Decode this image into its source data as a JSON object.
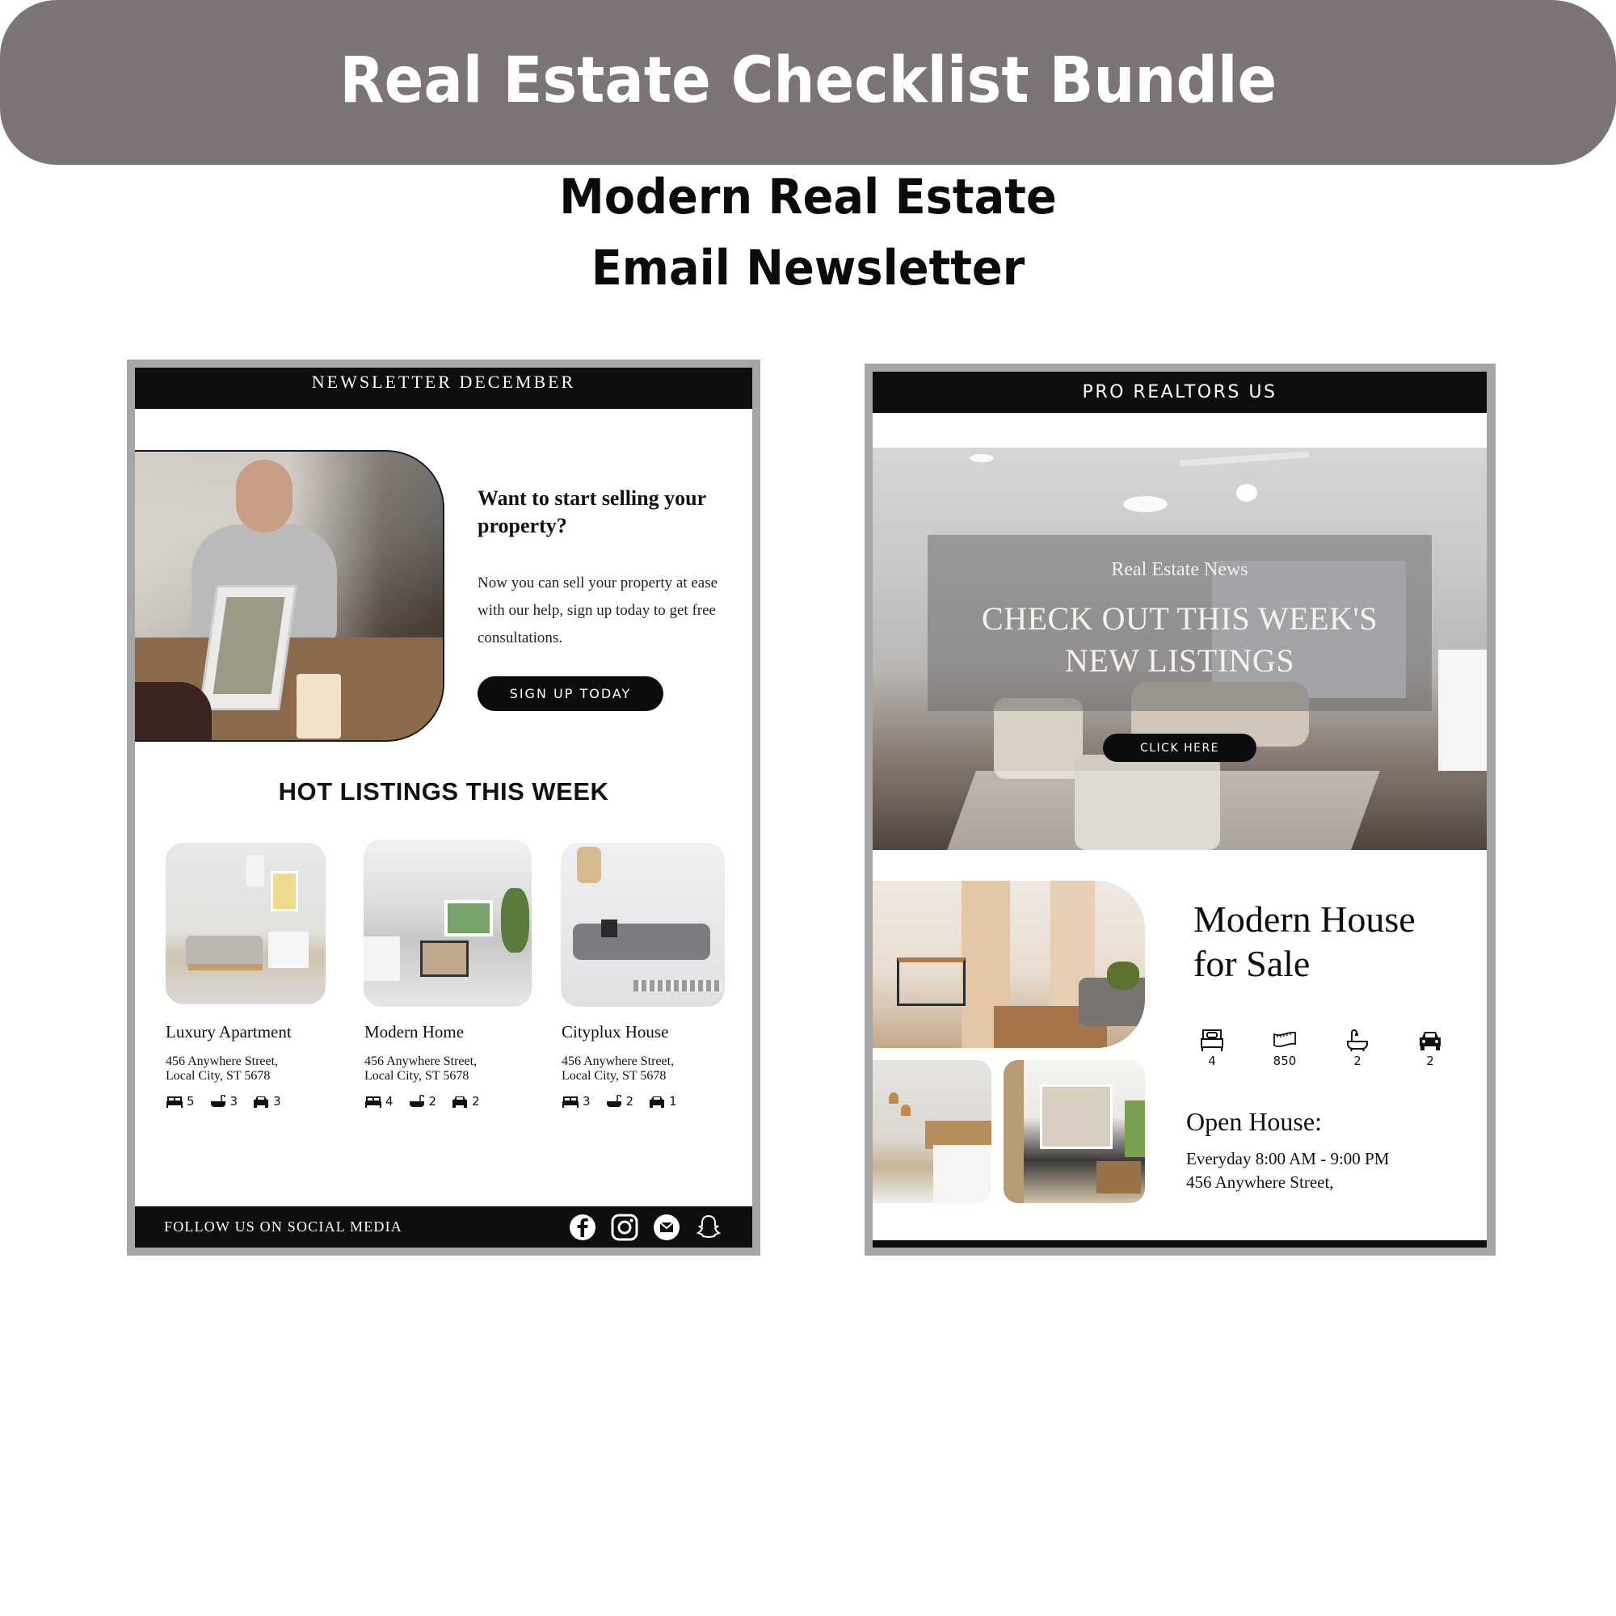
{
  "banner": {
    "title": "Real Estate Checklist Bundle",
    "color": "#7d7477"
  },
  "subtitle": {
    "line1": "Modern Real Estate",
    "line2": "Email Newsletter"
  },
  "left_newsletter": {
    "header": "NEWSLETTER DECEMBER",
    "hero": {
      "image": "business-meeting-laptop-photo",
      "heading": "Want to start selling your property?",
      "body": "Now you can sell your property at ease with our help, sign up today to get free consultations.",
      "button": "SIGN UP TODAY"
    },
    "section_title": "HOT LISTINGS THIS WEEK",
    "listings": [
      {
        "name": "Luxury Apartment",
        "address_line1": "456 Anywhere Street,",
        "address_line2": "Local City, ST 5678",
        "beds": "5",
        "baths": "3",
        "cars": "3",
        "image": "living-room-wooden-sofa-photo"
      },
      {
        "name": "Modern Home",
        "address_line1": "456 Anywhere Street,",
        "address_line2": "Local City, ST 5678",
        "beds": "4",
        "baths": "2",
        "cars": "2",
        "image": "living-room-coffee-table-photo"
      },
      {
        "name": "Cityplux House",
        "address_line1": "456 Anywhere Street,",
        "address_line2": "Local City, ST 5678",
        "beds": "3",
        "baths": "2",
        "cars": "1",
        "image": "grey-sofa-living-room-photo"
      }
    ],
    "footer": {
      "label": "FOLLOW US ON SOCIAL MEDIA",
      "social_icons": [
        "facebook-icon",
        "instagram-icon",
        "email-icon",
        "snapchat-icon"
      ]
    }
  },
  "right_newsletter": {
    "header": "PRO REALTORS US",
    "hero": {
      "image": "living-room-ceiling-fan-photo",
      "kicker": "Real Estate News",
      "headline_line1": "CHECK OUT THIS WEEK'S",
      "headline_line2": "NEW LISTINGS",
      "button": "CLICK HERE"
    },
    "gallery": [
      "living-room-plants-photo",
      "bedroom-pendant-lamps-photo",
      "shelves-living-room-photo"
    ],
    "property": {
      "title_line1": "Modern House",
      "title_line2": "for Sale",
      "features": [
        {
          "icon": "bed-icon",
          "value": "4"
        },
        {
          "icon": "area-measure-icon",
          "value": "850"
        },
        {
          "icon": "bathtub-icon",
          "value": "2"
        },
        {
          "icon": "car-icon",
          "value": "2"
        }
      ],
      "open_house_label": "Open House:",
      "hours": "Everyday 8:00 AM - 9:00 PM",
      "address": "456 Anywhere Street,"
    }
  }
}
